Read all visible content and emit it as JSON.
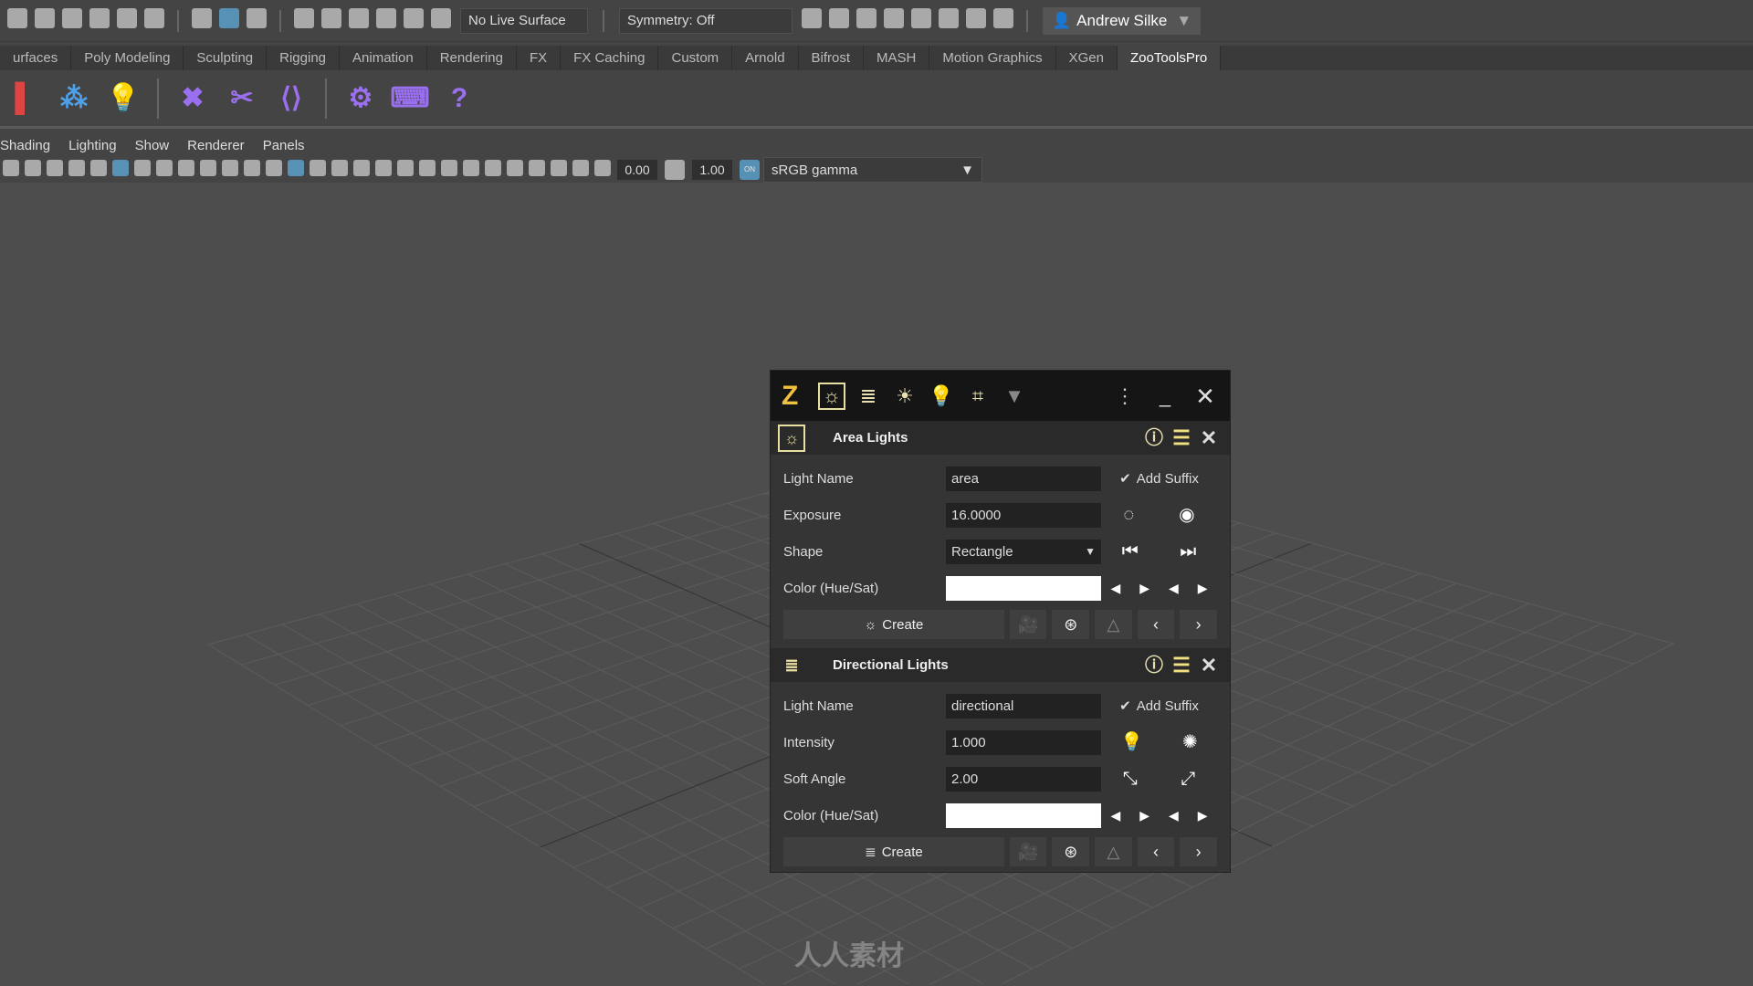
{
  "topbar": {
    "icons_left": [
      "menu-dropdown-icon",
      "new-scene-icon",
      "open-scene-icon",
      "save-scene-icon",
      "undo-icon",
      "redo-icon"
    ],
    "select_icons": [
      "select-hierarchy-icon",
      "select-object-icon",
      "select-component-icon"
    ],
    "snap_icons": [
      "snap-grid-icon",
      "snap-curve-icon",
      "snap-point-icon",
      "snap-projected-icon",
      "snap-view-plane-icon",
      "make-live-icon"
    ],
    "live_surface": "No Live Surface",
    "symmetry": "Symmetry: Off",
    "render_icons": [
      "render-view-icon",
      "render-frame-icon",
      "ipr-render-icon",
      "render-settings-icon",
      "hypershade-icon",
      "render-setup-icon",
      "light-editor-icon",
      "pause-icon"
    ],
    "user": "Andrew Silke"
  },
  "shelf_tabs": [
    {
      "label": "urfaces"
    },
    {
      "label": "Poly Modeling"
    },
    {
      "label": "Sculpting"
    },
    {
      "label": "Rigging"
    },
    {
      "label": "Animation"
    },
    {
      "label": "Rendering"
    },
    {
      "label": "FX"
    },
    {
      "label": "FX Caching"
    },
    {
      "label": "Custom"
    },
    {
      "label": "Arnold"
    },
    {
      "label": "Bifrost"
    },
    {
      "label": "MASH"
    },
    {
      "label": "Motion Graphics"
    },
    {
      "label": "XGen"
    },
    {
      "label": "ZooToolsPro",
      "active": true
    }
  ],
  "shelf_icons": [
    {
      "name": "shelf-red-icon",
      "glyph": "▌",
      "color": "#d44"
    },
    {
      "name": "shelf-nodes-icon",
      "glyph": "⁂",
      "color": "#4ea0e8"
    },
    {
      "name": "shelf-light-bulb-icon",
      "glyph": "💡",
      "color": "#f0e060"
    },
    {
      "name": "shelf-tools-icon",
      "glyph": "✖",
      "color": "#9a6ff0"
    },
    {
      "name": "shelf-knife-icon",
      "glyph": "✂",
      "color": "#9a6ff0"
    },
    {
      "name": "shelf-script-icon",
      "glyph": "⟨⟩",
      "color": "#9a6ff0"
    },
    {
      "name": "shelf-settings-icon",
      "glyph": "⚙",
      "color": "#9a6ff0"
    },
    {
      "name": "shelf-hotkeys-icon",
      "glyph": "⌨",
      "color": "#9a6ff0"
    },
    {
      "name": "shelf-help-icon",
      "glyph": "?",
      "color": "#9a6ff0"
    }
  ],
  "panel_menu": [
    "Shading",
    "Lighting",
    "Show",
    "Renderer",
    "Panels"
  ],
  "panel_toolbar": {
    "exposure": "0.00",
    "gamma": "1.00",
    "color_mgmt": "sRGB gamma",
    "color_mgmt_toggle": "ON"
  },
  "window": {
    "logo": "Z",
    "title_icons": [
      "area-light-icon",
      "directional-light-icon",
      "sky-dome-icon",
      "light-bulb-icon",
      "hdri-icon",
      "more-dropdown-icon"
    ],
    "area": {
      "title": "Area Lights",
      "light_name_label": "Light Name",
      "light_name": "area",
      "add_suffix": "Add Suffix",
      "add_suffix_checked": true,
      "exposure_label": "Exposure",
      "exposure": "16.0000",
      "shape_label": "Shape",
      "shape": "Rectangle",
      "color_label": "Color (Hue/Sat)",
      "color": "#ffffff",
      "create": "Create"
    },
    "directional": {
      "title": "Directional Lights",
      "light_name_label": "Light Name",
      "light_name": "directional",
      "add_suffix": "Add Suffix",
      "add_suffix_checked": true,
      "intensity_label": "Intensity",
      "intensity": "1.000",
      "soft_angle_label": "Soft Angle",
      "soft_angle": "2.00",
      "color_label": "Color (Hue/Sat)",
      "color": "#ffffff",
      "create": "Create"
    }
  },
  "watermark": "人人素材",
  "colors": {
    "accent_yellow": "#e8e0a0",
    "shelf_purple": "#9a6ff0",
    "selected_blue": "#5a9fc9"
  }
}
